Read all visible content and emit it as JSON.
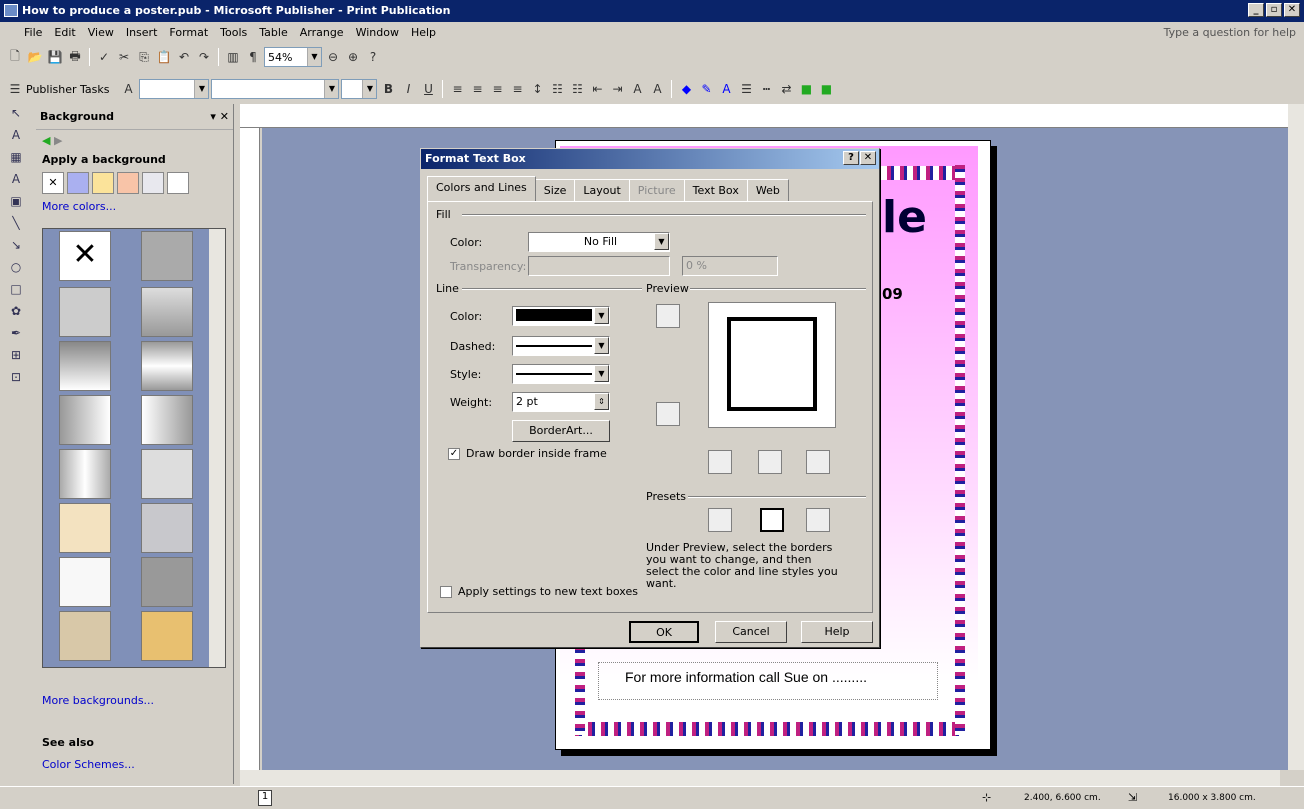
{
  "window": {
    "title": "How to produce a poster.pub - Microsoft Publisher - Print Publication",
    "help_placeholder": "Type a question for help"
  },
  "menu": [
    "File",
    "Edit",
    "View",
    "Insert",
    "Format",
    "Tools",
    "Table",
    "Arrange",
    "Window",
    "Help"
  ],
  "toolbar": {
    "zoom": "54%",
    "publisher_tasks": "Publisher Tasks"
  },
  "taskpane": {
    "title": "Background",
    "section": "Apply a background",
    "more_colors": "More colors...",
    "more_backgrounds": "More backgrounds...",
    "see_also": "See also",
    "color_schemes": "Color Schemes..."
  },
  "dialog": {
    "title": "Format Text Box",
    "tabs": [
      "Colors and Lines",
      "Size",
      "Layout",
      "Picture",
      "Text Box",
      "Web"
    ],
    "fill_label": "Fill",
    "color_label": "Color:",
    "fill_color": "No Fill",
    "transparency_label": "Transparency:",
    "transparency_value": "0 %",
    "line_label": "Line",
    "line_color_label": "Color:",
    "dashed_label": "Dashed:",
    "style_label": "Style:",
    "weight_label": "Weight:",
    "weight_value": "2 pt",
    "borderart": "BorderArt...",
    "draw_border": "Draw border inside frame",
    "preview_label": "Preview",
    "presets_label": "Presets",
    "hint": "Under Preview, select the borders you want to change, and then select the color and line styles you want.",
    "apply_new": "Apply settings to new text boxes",
    "ok": "OK",
    "cancel": "Cancel",
    "help": "Help"
  },
  "poster": {
    "title_fragment": "le",
    "number_fragment": "09",
    "info": "For more information call Sue on ........."
  },
  "status": {
    "page": "1",
    "position": "2.400, 6.600 cm.",
    "size": "16.000 x 3.800 cm."
  }
}
